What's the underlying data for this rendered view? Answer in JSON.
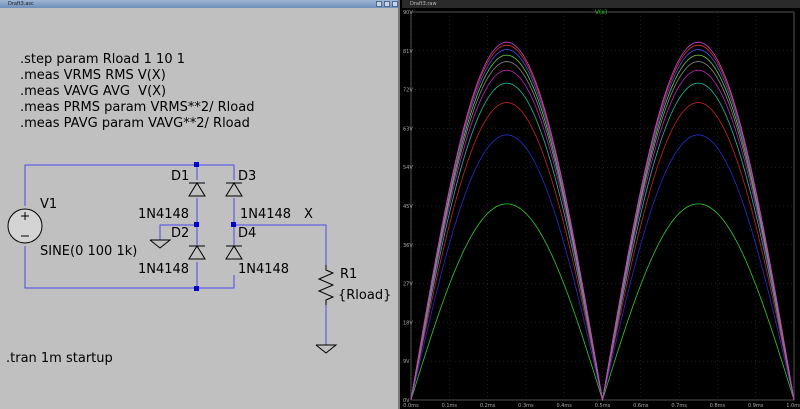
{
  "schematic_window": {
    "title": "Draft3.asc",
    "directives": [
      ".step param Rload 1 10 1",
      ".meas VRMS RMS V(X)",
      ".meas VAVG AVG  V(X)",
      ".meas PRMS param VRMS**2/ Rload",
      ".meas PAVG param VAVG**2/ Rload"
    ],
    "tran_directive": ".tran 1m startup",
    "components": {
      "source_name": "V1",
      "source_value": "SINE(0 100 1k)",
      "d1_name": "D1",
      "d1_model": "1N4148",
      "d2_name": "D2",
      "d2_model": "1N4148",
      "d3_name": "D3",
      "d3_model": "1N4148",
      "d4_name": "D4",
      "d4_model": "1N4148",
      "net_label": "X",
      "r1_name": "R1",
      "r1_value": "{Rload}"
    },
    "colors": {
      "background": "#c0c0c0",
      "wire": "#4a4af0",
      "junction": "#0000cc"
    }
  },
  "plot_window": {
    "title": "Draft3.raw",
    "trace_label": "V(x)",
    "colors": {
      "background": "#000000",
      "grid": "#3a3a3a",
      "trace_label": "#22cc22"
    },
    "chart_data": {
      "type": "line",
      "title": "V(x)",
      "xlabel": "",
      "ylabel": "",
      "x_ticks": [
        "0.0ms",
        "0.1ms",
        "0.2ms",
        "0.3ms",
        "0.4ms",
        "0.5ms",
        "0.6ms",
        "0.7ms",
        "0.8ms",
        "0.9ms",
        "1.0ms"
      ],
      "y_ticks": [
        "0V",
        "9V",
        "18V",
        "27V",
        "36V",
        "45V",
        "54V",
        "63V",
        "72V",
        "81V",
        "90V"
      ],
      "xlim": [
        0,
        1.0
      ],
      "ylim": [
        0,
        90
      ],
      "grid": true,
      "series": [
        {
          "peak": 45.5,
          "color": "#33cc33"
        },
        {
          "peak": 61.5,
          "color": "#2a2ad0"
        },
        {
          "peak": 69.0,
          "color": "#cc2222"
        },
        {
          "peak": 73.5,
          "color": "#22bb99"
        },
        {
          "peak": 76.5,
          "color": "#bb22bb"
        },
        {
          "peak": 78.5,
          "color": "#888888"
        },
        {
          "peak": 80.0,
          "color": "#66cc44"
        },
        {
          "peak": 81.3,
          "color": "#4455ee"
        },
        {
          "peak": 82.3,
          "color": "#dd3333"
        },
        {
          "peak": 83.0,
          "color": "#cc44cc"
        }
      ]
    }
  }
}
